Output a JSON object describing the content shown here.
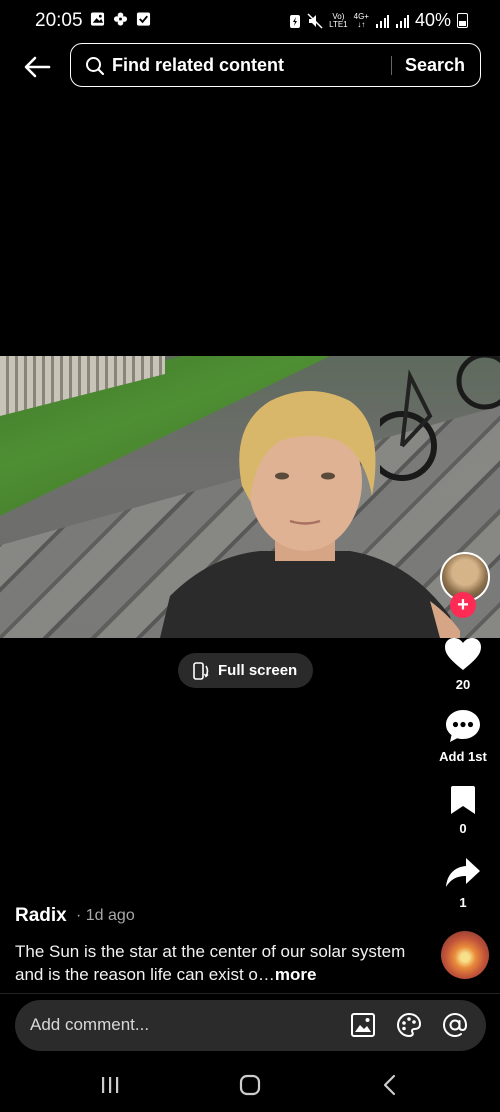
{
  "status_bar": {
    "time": "20:05",
    "signal_top": "Vo)",
    "signal_bottom": "LTE1",
    "network_top": "4G+",
    "network_bottom": "↓↑",
    "battery": "40%"
  },
  "search": {
    "placeholder": "Find related content",
    "button": "Search"
  },
  "video": {
    "fullscreen_label": "Full screen"
  },
  "actions": {
    "likes": "20",
    "comments": "Add 1st",
    "saves": "0",
    "shares": "1"
  },
  "post": {
    "username": "Radix",
    "posted": "· 1d ago",
    "caption": "The Sun is the star at the center of our solar system and is the reason life can exist o…",
    "more": "more"
  },
  "comment": {
    "placeholder": "Add comment..."
  },
  "colors": {
    "accent": "#fe2c55",
    "background": "#000000",
    "comment_bar": "#2b2b2b"
  }
}
